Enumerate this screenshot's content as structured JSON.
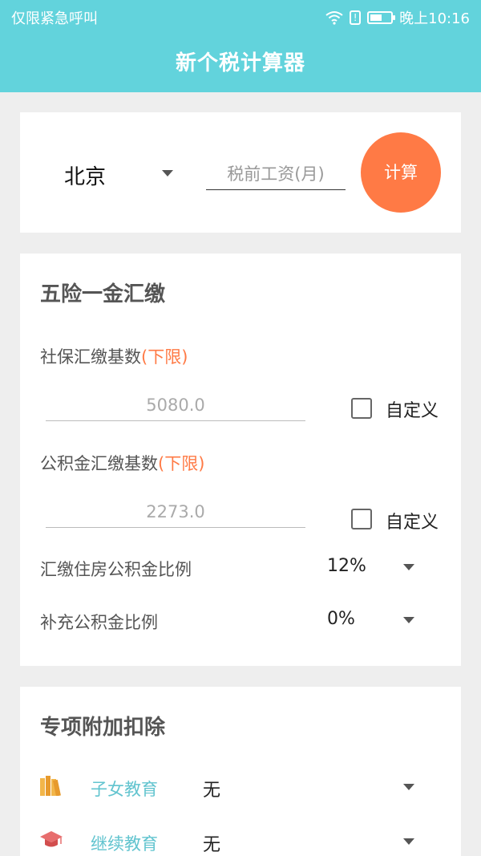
{
  "status_bar": {
    "left_text": "仅限紧急呼叫",
    "time": "晚上10:16"
  },
  "app": {
    "title": "新个税计算器"
  },
  "calculator": {
    "city": "北京",
    "salary_placeholder": "税前工资(月)",
    "calc_button": "计算"
  },
  "insurance": {
    "title": "五险一金汇缴",
    "social_base_label": "社保汇缴基数",
    "social_base_note": "(下限)",
    "social_base_value": "5080.0",
    "fund_base_label": "公积金汇缴基数",
    "fund_base_note": "(下限)",
    "fund_base_value": "2273.0",
    "custom_label": "自定义",
    "fund_ratio_label": "汇缴住房公积金比例",
    "fund_ratio_value": "12%",
    "extra_fund_label": "补充公积金比例",
    "extra_fund_value": "0%"
  },
  "deductions": {
    "title": "专项附加扣除",
    "items": [
      {
        "icon": "books-icon",
        "label": "子女教育",
        "value": "无"
      },
      {
        "icon": "graduation-cap-icon",
        "label": "继续教育",
        "value": "无"
      }
    ]
  },
  "colors": {
    "accent": "#62d3dc",
    "orange": "#ff7a45",
    "link": "#62c4cf"
  }
}
